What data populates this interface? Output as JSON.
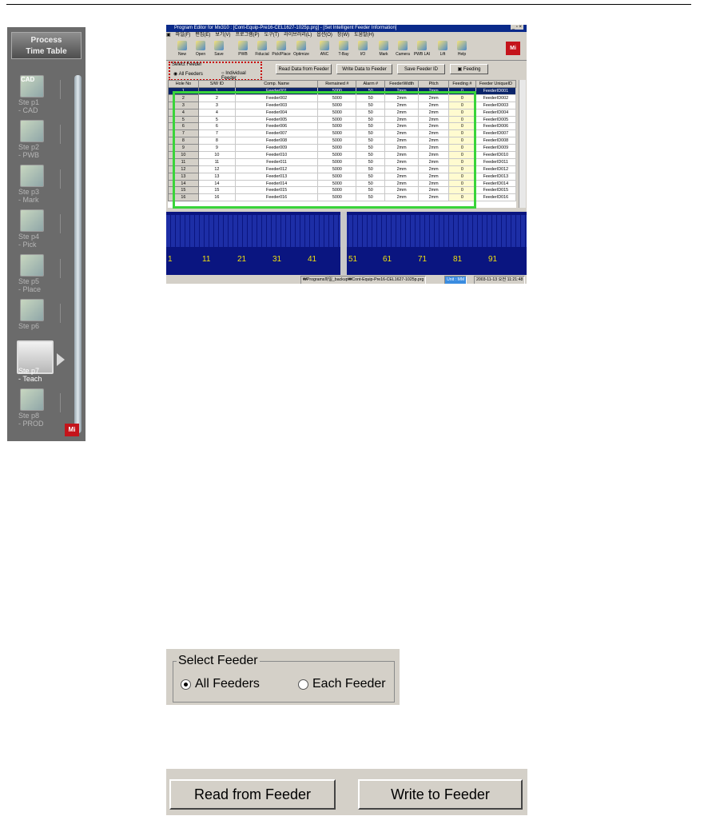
{
  "left_panel": {
    "title_line1": "Process",
    "title_line2": "Time Table",
    "steps": [
      {
        "label": "Ste p1\n- CAD",
        "icon_text": "CAD"
      },
      {
        "label": "Ste p2\n- PWB"
      },
      {
        "label": "Ste p3\n- Mark"
      },
      {
        "label": "Ste p4\n- Pick"
      },
      {
        "label": "Ste p5\n- Place"
      },
      {
        "label": "Ste p6"
      },
      {
        "label": "Ste p7\n- Teach"
      },
      {
        "label": "Ste p8\n- PROD"
      }
    ],
    "logo_text": "Mi"
  },
  "window": {
    "title": "Program Editor for Mx310 : [Cont-Equip-Pre16-CEL1627-1025p.prg] - [Set Intelligent Feeder Information]",
    "title_controls": "_ ▫ ×",
    "menu": [
      "파일(F)",
      "편집(E)",
      "보기(V)",
      "프로그램(P)",
      "도구(T)",
      "라이브러리(L)",
      "옵션(O)",
      "창(W)",
      "도움말(H)"
    ],
    "toolbar": [
      "New",
      "Open",
      "Save",
      "PWB",
      "Fiducial",
      "Pick/Place",
      "Optimize",
      "ANC",
      "T-Bay",
      "I/O",
      "Mark",
      "Camera",
      "PWB LAI",
      "Lift",
      "Help"
    ],
    "toolbar_logo": "Mi",
    "select_feeder": {
      "title": "Select Feeder",
      "option1": "All Feeders",
      "option2": "Individual Feeder"
    },
    "buttons": {
      "read": "Read Data from Feeder",
      "write": "Write Data to Feeder",
      "save_id": "Save Feeder ID",
      "feeding": "Feeding"
    },
    "table": {
      "headers": [
        "Hole No",
        "S/W ID",
        "Comp. Name",
        "Remained #",
        "Alarm #",
        "FeederWidth",
        "Pitch",
        "Feeding #",
        "Feeder UniqueID"
      ],
      "rows": [
        [
          "1",
          "1",
          "Feeder001",
          "5000",
          "50",
          "2mm",
          "2mm",
          "0",
          "FeederID001"
        ],
        [
          "2",
          "2",
          "Feeder002",
          "5000",
          "50",
          "2mm",
          "2mm",
          "0",
          "FeederID002"
        ],
        [
          "3",
          "3",
          "Feeder003",
          "5000",
          "50",
          "2mm",
          "2mm",
          "0",
          "FeederID003"
        ],
        [
          "4",
          "4",
          "Feeder004",
          "5000",
          "50",
          "2mm",
          "2mm",
          "0",
          "FeederID004"
        ],
        [
          "5",
          "5",
          "Feeder005",
          "5000",
          "50",
          "2mm",
          "2mm",
          "0",
          "FeederID005"
        ],
        [
          "6",
          "6",
          "Feeder006",
          "5000",
          "50",
          "2mm",
          "2mm",
          "0",
          "FeederID006"
        ],
        [
          "7",
          "7",
          "Feeder007",
          "5000",
          "50",
          "2mm",
          "2mm",
          "0",
          "FeederID007"
        ],
        [
          "8",
          "8",
          "Feeder008",
          "5000",
          "50",
          "2mm",
          "2mm",
          "0",
          "FeederID008"
        ],
        [
          "9",
          "9",
          "Feeder009",
          "5000",
          "50",
          "2mm",
          "2mm",
          "0",
          "FeederID009"
        ],
        [
          "10",
          "10",
          "Feeder010",
          "5000",
          "50",
          "2mm",
          "2mm",
          "0",
          "FeederID010"
        ],
        [
          "11",
          "11",
          "Feeder011",
          "5000",
          "50",
          "2mm",
          "2mm",
          "0",
          "FeederID011"
        ],
        [
          "12",
          "12",
          "Feeder012",
          "5000",
          "50",
          "2mm",
          "2mm",
          "0",
          "FeederID012"
        ],
        [
          "13",
          "13",
          "Feeder013",
          "5000",
          "50",
          "2mm",
          "2mm",
          "0",
          "FeederID013"
        ],
        [
          "14",
          "14",
          "Feeder014",
          "5000",
          "50",
          "2mm",
          "2mm",
          "0",
          "FeederID014"
        ],
        [
          "15",
          "15",
          "Feeder015",
          "5000",
          "50",
          "2mm",
          "2mm",
          "0",
          "FeederID015"
        ],
        [
          "16",
          "16",
          "Feeder016",
          "5000",
          "50",
          "2mm",
          "2mm",
          "0",
          "FeederID016"
        ]
      ]
    },
    "feeder_labels": [
      "1",
      "11",
      "21",
      "31",
      "41",
      "51",
      "61",
      "71",
      "81",
      "91"
    ],
    "status": {
      "path": "₩Programs파일_backup₩Cont-Equip-Pre16-CEL1627-1025p.prg",
      "unit": "Unit : MM",
      "datetime": "2003-11-13  오전 11:21:48"
    }
  },
  "zoom_select": {
    "title": "Select Feeder",
    "option1": "All Feeders",
    "option2": "Each Feeder"
  },
  "zoom_buttons": {
    "read": "Read from Feeder",
    "write": "Write to Feeder"
  }
}
